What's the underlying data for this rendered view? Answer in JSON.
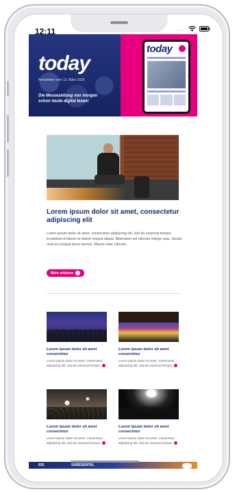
{
  "status_bar": {
    "time": "12:11",
    "signal_dots": "....",
    "wifi_icon": "wifi-icon",
    "battery_icon": "battery-icon"
  },
  "header": {
    "logo": "today",
    "newsletter_line": "Newsletter vom 13. März 2026",
    "tagline": "Die Messezeitung von morgen schon heute digital lesen!",
    "magazine_logo": "today",
    "magazine_arrow_icon": "chevron-right-icon"
  },
  "main_article": {
    "title": "Lorem ipsum dolor sit amet, consectetur adipiscing elit",
    "body": "Lorem ipsum dolor sit amet, consectetur adipiscing elit, sed do eiusmod tempor incididunt ut labore et dolore magna aliqua. Bibendum est ultricies integer quis. Iaculis urna id volutpat lacus laoreet. Mauris vitae ultricies.",
    "button_label": "Mehr erfahren"
  },
  "cards": [
    {
      "title": "Lorem ipsum dolor sit amet consectetur",
      "text": "Lorem ipsum dolor sit amet, consectetur adipiscing elit, sed do eiusmod tempor."
    },
    {
      "title": "Lorem ipsum dolor sit amet consectetur",
      "text": "Lorem ipsum dolor sit amet, consectetur adipiscing elit, sed do eiusmod tempor."
    },
    {
      "title": "Lorem ipsum dolor sit amet consectetur",
      "text": "Lorem ipsum dolor sit amet, consectetur adipiscing elit, sed do eiusmod tempor."
    },
    {
      "title": "Lorem ipsum dolor sit amet consectetur",
      "text": "Lorem ipsum dolor sit amet, consectetur adipiscing elit, sed do eiusmod tempor."
    }
  ],
  "footer": {
    "ids_label": "IDS",
    "sponsor_label": "SAREDENTAL"
  },
  "colors": {
    "brand_blue": "#1b2a6b",
    "accent_pink": "#e6007e"
  }
}
